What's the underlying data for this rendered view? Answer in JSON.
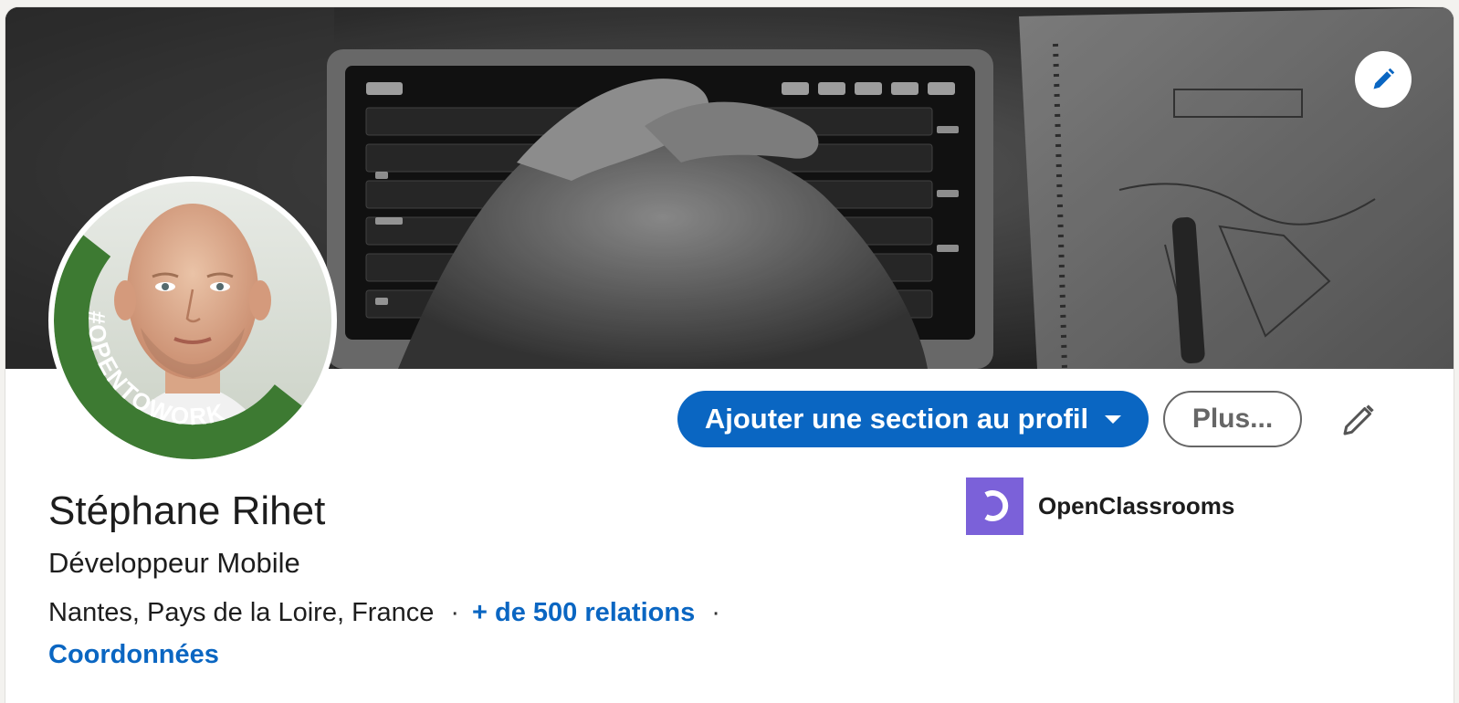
{
  "profile": {
    "name": "Stéphane Rihet",
    "headline": "Développeur Mobile",
    "location": "Nantes, Pays de la Loire, France",
    "connections_link": "+ de 500 relations",
    "contact_link": "Coordonnées",
    "frame_text": "#OPENTOWORK"
  },
  "actions": {
    "add_section_label": "Ajouter une section au profil",
    "more_label": "Plus..."
  },
  "company": {
    "name": "OpenClassrooms"
  },
  "icons": {
    "cover_edit": "pencil-icon",
    "intro_edit": "pencil-icon",
    "dropdown": "caret-down-icon",
    "company_logo": "openclassrooms-logo"
  },
  "colors": {
    "primary": "#0a66c2",
    "open_to_work_frame": "#3d7a32",
    "company_logo_bg": "#7b61d9"
  }
}
